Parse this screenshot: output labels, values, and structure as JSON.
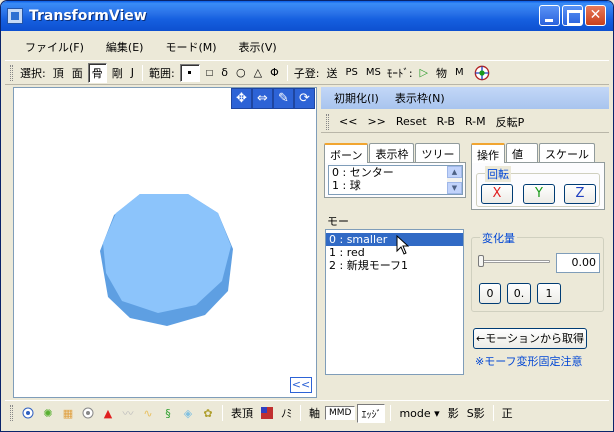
{
  "window": {
    "title": "TransformView",
    "controls": [
      "minimize",
      "maximize",
      "close"
    ]
  },
  "menu": [
    "ファイル(F)",
    "編集(E)",
    "モード(M)",
    "表示(V)"
  ],
  "toolbar": {
    "select_label": "選択:",
    "select_items": [
      "頂",
      "面",
      "骨",
      "剛",
      "J"
    ],
    "select_selected": "骨",
    "range_label": "範囲:",
    "range_items": [
      "□",
      "δ",
      "○",
      "△",
      "Φ"
    ],
    "child_label": "子登:",
    "child_items": [
      "送",
      "PS",
      "MS"
    ],
    "mode_label": "ﾓｰﾄﾞ:",
    "mode_items": [
      "▷",
      "物",
      "M"
    ]
  },
  "viewport": {
    "collapse_label": "<<",
    "tool_icons": [
      "move-xy-icon",
      "move-arrows-icon",
      "pencil-icon",
      "rotate-icon"
    ],
    "shape_color": "#88c0f8",
    "shape_shadow_color": "#5b9be0"
  },
  "right_panel": {
    "header_items": [
      "初期化(I)",
      "表示枠(N)"
    ],
    "toolbar_items": [
      "<<",
      ">>",
      "Reset",
      "R-B",
      "R-M",
      "反転P"
    ],
    "bone_tabs": [
      "ボーン",
      "表示枠",
      "ツリー"
    ],
    "bone_list": [
      "0 : センター",
      "1 : 球"
    ],
    "op_tabs": [
      "操作",
      "値",
      "スケール"
    ],
    "rotation_label": "回転",
    "axis_buttons": [
      {
        "label": "X",
        "color": "#e02020"
      },
      {
        "label": "Y",
        "color": "#1a9a1a"
      },
      {
        "label": "Z",
        "color": "#2040c0"
      }
    ],
    "morph_label": "モー",
    "morph_list": [
      "0 : smaller",
      "1 : red",
      "2 : 新規モーフ1"
    ],
    "morph_selected": "0 : smaller",
    "change_label": "変化量",
    "change_value": "0.00",
    "change_slider_fraction": 0.0,
    "preset_buttons": [
      "0",
      "0.",
      "1"
    ],
    "get_from_motion_label": "←モーションから取得",
    "morph_note": "※モーフ変形固定注意"
  },
  "bottom_toolbar": {
    "labels": [
      "表頂",
      "ﾉﾐ",
      "軸",
      "ｴｯｼﾞ",
      "mode ▾",
      "影",
      "S影",
      "正"
    ],
    "mo_label": "MMD"
  }
}
